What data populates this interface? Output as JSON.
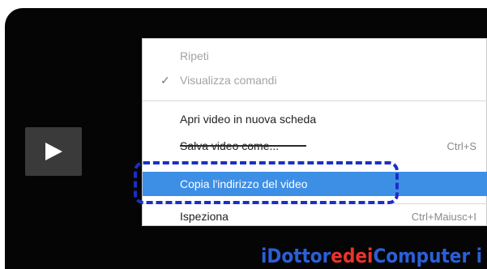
{
  "video": {
    "play_icon": "play-icon"
  },
  "context_menu": {
    "items": [
      {
        "label": "Ripeti",
        "disabled": true
      },
      {
        "label": "Visualizza comandi",
        "checked": true,
        "disabled": true
      },
      {
        "label": "Apri video in nuova scheda"
      },
      {
        "label": "Salva video come...",
        "shortcut": "Ctrl+S"
      },
      {
        "label": "Copia l'indirizzo del video",
        "highlighted": true
      },
      {
        "label": "Ispeziona",
        "shortcut": "Ctrl+Maiusc+I"
      }
    ],
    "check_mark": "✓",
    "highlight_color": "#3d8fe6",
    "annotation_color": "#1c2fc4"
  },
  "watermark": {
    "part1": "iDottor",
    "part2": "edei",
    "part3": "Computer i"
  }
}
